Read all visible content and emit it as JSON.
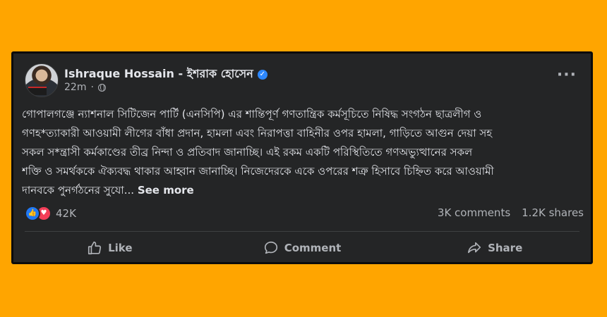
{
  "post": {
    "author": "Ishraque Hossain - ইশরাক হোসেন",
    "time": "22m",
    "dot": "·",
    "text_lines": [
      "গোপালগঞ্জে ন্যাশনাল সিটিজেন পার্টি (এনসিপি) এর শান্তিপূর্ণ গণতান্ত্রিক কর্মসূচিতে নিষিদ্ধ সংগঠন ছাত্রলীগ ও",
      "গণহ*ত্যাকারী আওয়ামী লীগের বাঁধা প্রদান, হামলা এবং নিরাপত্তা বাহিনীর ওপর হামলা, গাড়িতে আগুন দেয়া সহ",
      "সকল স*ন্ত্রাসী কর্মকাণ্ডের তীব্র নিন্দা ও প্রতিবাদ জানাচ্ছি।  এই রকম একটি পরিস্থিতিতে গণঅভ্যুত্থানের সকল",
      "শক্তি ও সমর্থককে ঐক্যবদ্ধ থাকার আহ্বান জানাচ্ছি। নিজেদেরকে একে ওপরের শত্রু হিসাবে চিহ্নিত করে আওয়ামী"
    ],
    "last_line": "দানবকে পুনর্গঠনের সুযো...",
    "see_more": "See more"
  },
  "stats": {
    "reactions": "42K",
    "comments": "3K comments",
    "shares": "1.2K shares"
  },
  "actions": {
    "like": "Like",
    "comment": "Comment",
    "share": "Share"
  },
  "icons": {
    "verified": "verified-badge-icon",
    "globe": "globe-icon",
    "more": "more-options-icon"
  },
  "colors": {
    "background": "#FFA500",
    "card": "#242526",
    "text": "#e4e6eb",
    "muted": "#b0b3b8",
    "verified": "#2d88ff",
    "like": "#2078f4",
    "love": "#f33e58"
  }
}
